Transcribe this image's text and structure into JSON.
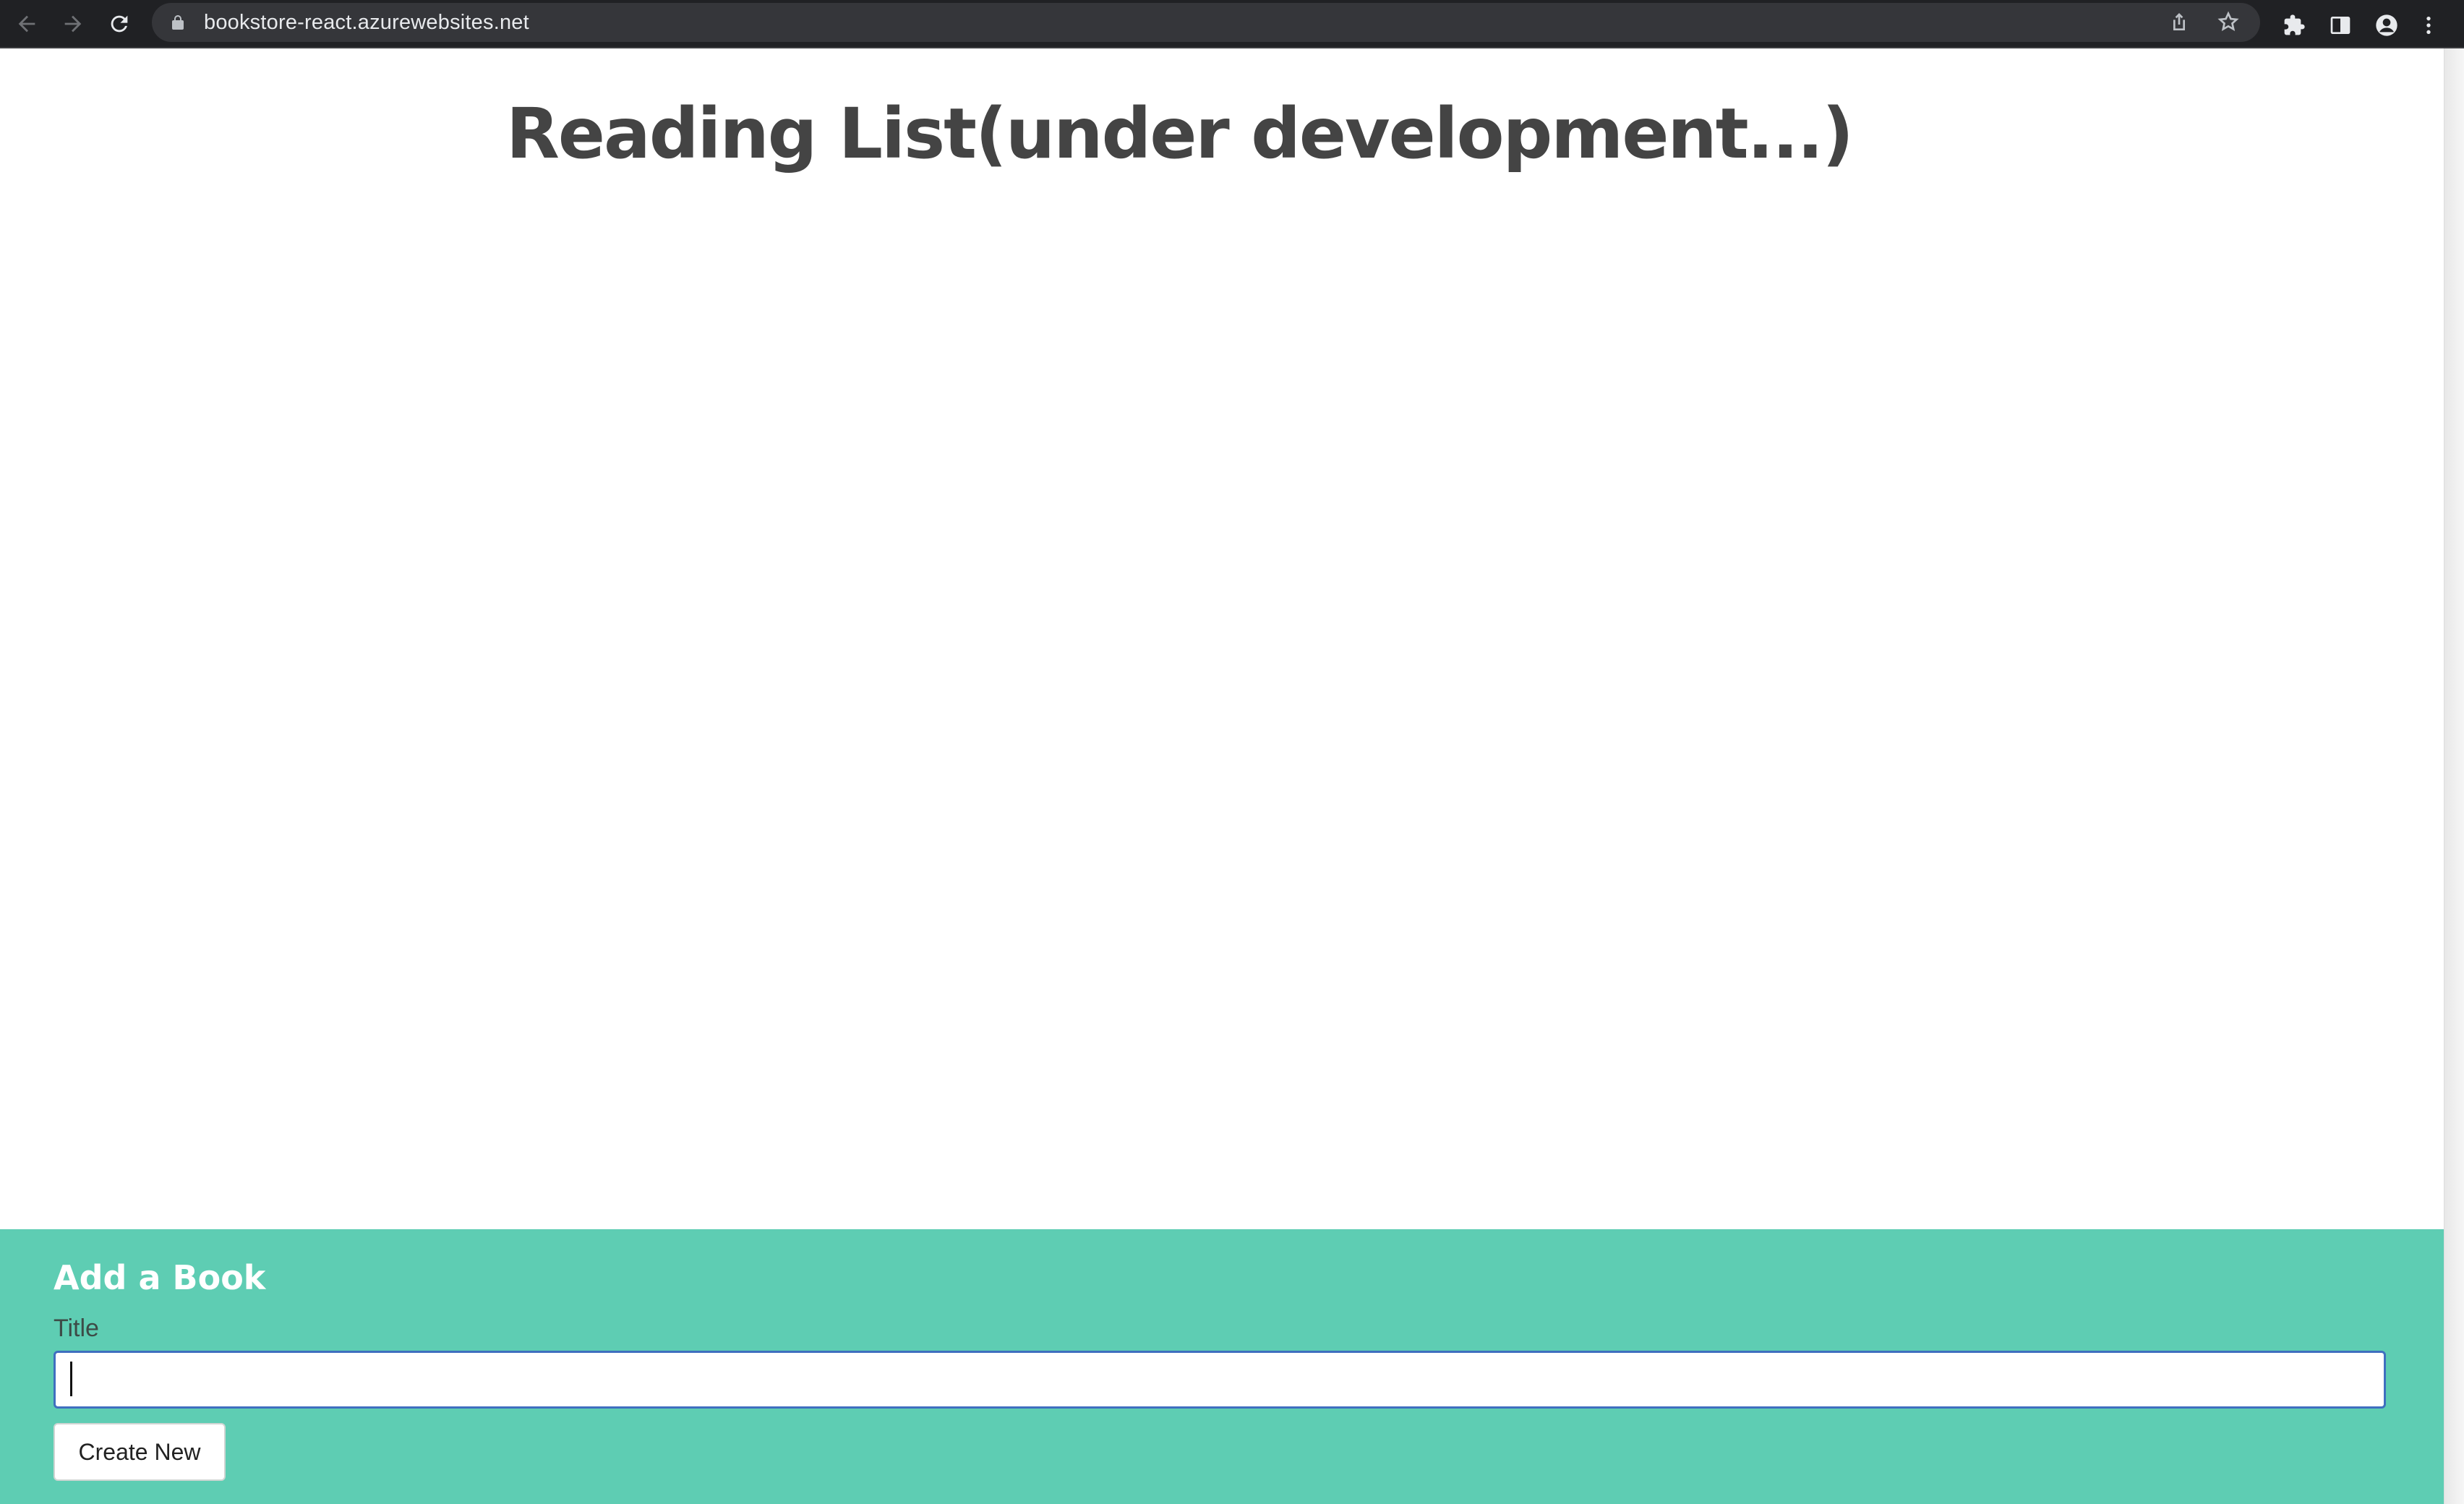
{
  "browser": {
    "url": "bookstore-react.azurewebsites.net",
    "icons": [
      "back-arrow-icon",
      "forward-arrow-icon",
      "reload-icon",
      "lock-icon",
      "share-icon",
      "star-icon",
      "extensions-icon",
      "side-panel-icon",
      "profile-icon",
      "menu-dots-icon"
    ]
  },
  "page": {
    "heading": "Reading List(under development...)"
  },
  "form": {
    "heading": "Add a Book",
    "title_label": "Title",
    "title_value": "",
    "title_placeholder": "",
    "submit_label": "Create New"
  },
  "colors": {
    "footer_bg": "#5ecdb3",
    "heading_text": "#444444",
    "input_focus_border": "#3f6fbf",
    "chrome_bg": "#202124"
  }
}
